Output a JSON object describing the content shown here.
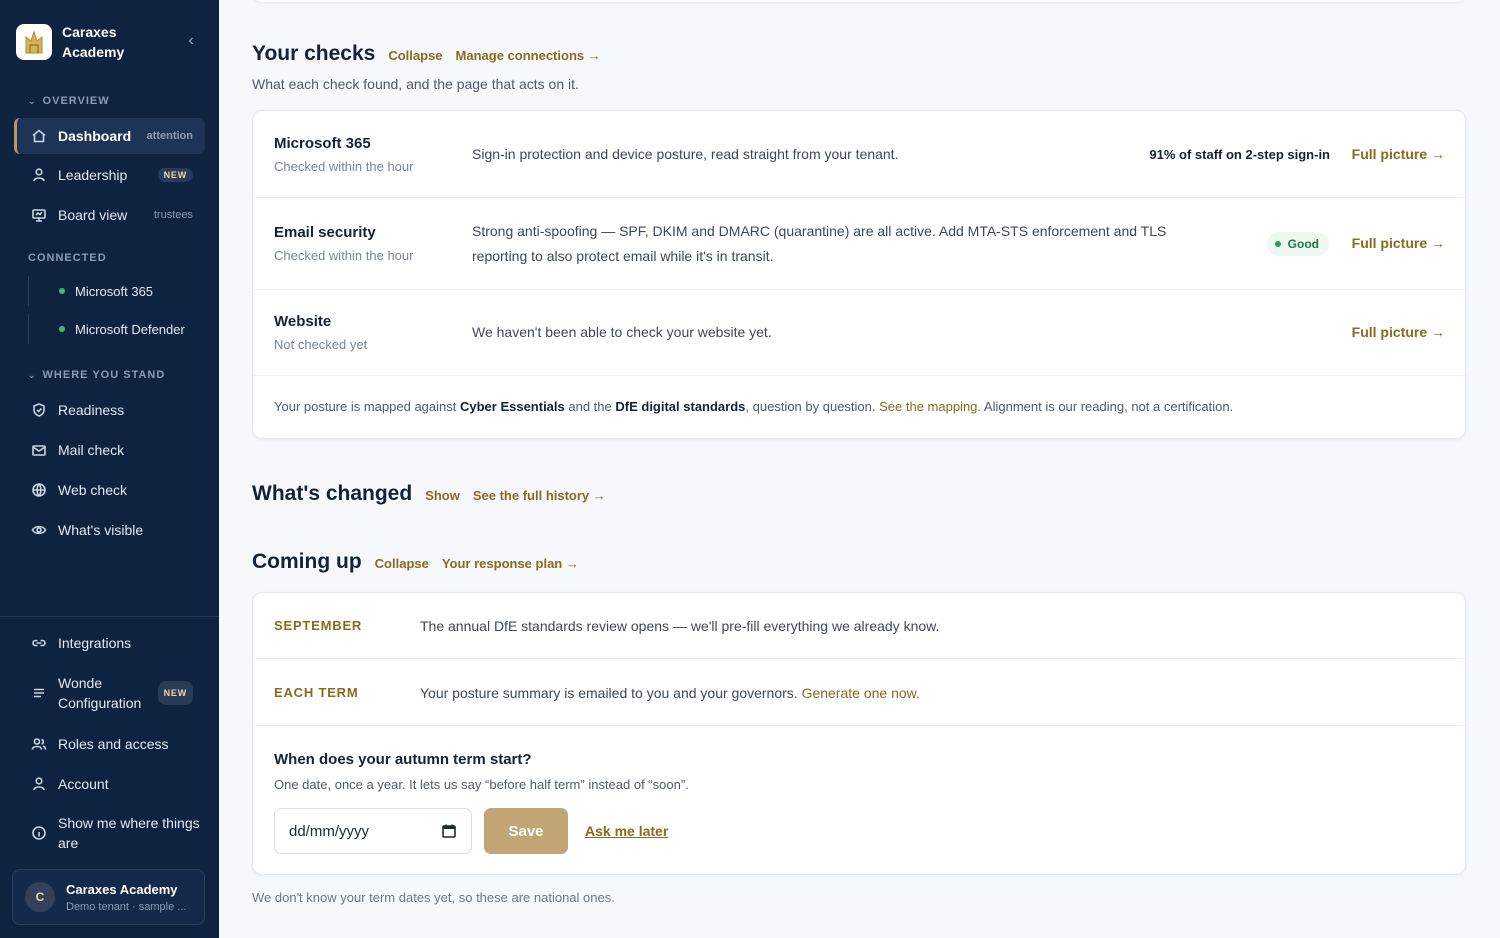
{
  "sidebar": {
    "brand": "Caraxes Academy",
    "sections": {
      "overview": "OVERVIEW",
      "connected": "CONNECTED",
      "where_you_stand": "WHERE YOU STAND"
    },
    "items": {
      "dashboard": {
        "label": "Dashboard",
        "hint": "attention"
      },
      "leadership": {
        "label": "Leadership",
        "badge": "NEW"
      },
      "board_view": {
        "label": "Board view",
        "hint": "trustees"
      },
      "m365": {
        "label": "Microsoft 365"
      },
      "defender": {
        "label": "Microsoft Defender"
      },
      "readiness": {
        "label": "Readiness"
      },
      "mail_check": {
        "label": "Mail check"
      },
      "web_check": {
        "label": "Web check"
      },
      "whats_visible": {
        "label": "What's visible"
      },
      "integrations": {
        "label": "Integrations"
      },
      "wonde": {
        "label_1": "Wonde",
        "label_2": "Configuration",
        "badge": "NEW"
      },
      "roles": {
        "label": "Roles and access"
      },
      "account": {
        "label": "Account"
      },
      "tour": {
        "label_1": "Show me where things",
        "label_2": "are"
      }
    },
    "account_card": {
      "initial": "C",
      "name": "Caraxes Academy",
      "sub": "Demo tenant · sample ..."
    },
    "icons": [
      "home-icon",
      "user-icon",
      "board-icon",
      "shield-icon",
      "mail-icon",
      "globe-icon",
      "eye-icon",
      "link-icon",
      "menu-icon",
      "users-icon",
      "user-icon",
      "info-icon",
      "chevron-left-icon",
      "calendar-icon"
    ],
    "accent_color": "#b59a5c",
    "status_color": "#3dbd74"
  },
  "checks": {
    "title": "Your checks",
    "collapse": "Collapse",
    "manage": "Manage connections →",
    "subtitle": "What each check found, and the page that acts on it.",
    "rows": [
      {
        "name": "Microsoft 365",
        "when": "Checked within the hour",
        "desc": "Sign-in protection and device posture, read straight from your tenant.",
        "stat": "91% of staff on 2-step sign-in",
        "link": "Full picture →"
      },
      {
        "name": "Email security",
        "when": "Checked within the hour",
        "desc_1": "Strong anti-spoofing — SPF, DKIM and DMARC (quarantine) are all active. Add MTA-STS enforcement and TLS",
        "desc_2": "reporting to also protect email while it's in transit.",
        "status": "Good",
        "link": "Full picture →"
      },
      {
        "name": "Website",
        "when": "Not checked yet",
        "desc": "We haven't been able to check your website yet.",
        "link": "Full picture →"
      }
    ],
    "mapping": {
      "p1": "Your posture is mapped against ",
      "b1": "Cyber Essentials",
      "p2": " and the ",
      "b2": "DfE digital standards",
      "p3": ", question by question. ",
      "link": "See the mapping.",
      "p4": " Alignment is our reading, not a certification."
    }
  },
  "changed": {
    "title": "What's changed",
    "show": "Show",
    "history": "See the full history →"
  },
  "coming": {
    "title": "Coming up",
    "collapse": "Collapse",
    "plan": "Your response plan →",
    "rows": [
      {
        "when": "SEPTEMBER",
        "msg": "The annual DfE standards review opens — we'll pre-fill everything we already know."
      },
      {
        "when": "EACH TERM",
        "msg": "Your posture summary is emailed to you and your governors. ",
        "link": "Generate one now."
      }
    ],
    "question": "When does your autumn term start?",
    "question_sub": "One date, once a year. It lets us say “before half term” instead of “soon”.",
    "date_placeholder": "dd/mm/yyyy",
    "save": "Save",
    "later": "Ask me later",
    "footnote": "We don't know your term dates yet, so these are national ones."
  }
}
